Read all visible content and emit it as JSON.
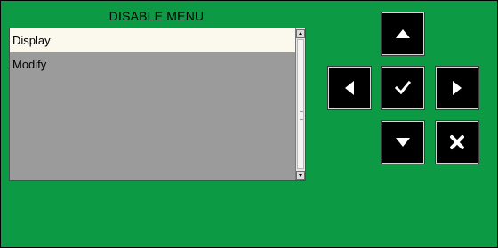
{
  "menu": {
    "title": "DISABLE MENU",
    "items": [
      {
        "label": "Display",
        "selected": true
      },
      {
        "label": "Modify",
        "selected": false
      }
    ]
  },
  "controls": {
    "buttons": [
      {
        "name": "up",
        "icon": "arrow-up-icon"
      },
      {
        "name": "left",
        "icon": "arrow-left-icon"
      },
      {
        "name": "confirm",
        "icon": "check-icon"
      },
      {
        "name": "right",
        "icon": "arrow-right-icon"
      },
      {
        "name": "down",
        "icon": "arrow-down-icon"
      },
      {
        "name": "cancel",
        "icon": "close-icon"
      }
    ]
  },
  "colors": {
    "background": "#0c9a45",
    "menu_panel": "#9b9b9b",
    "selected_item": "#fbf8ee",
    "button": "#000000"
  }
}
